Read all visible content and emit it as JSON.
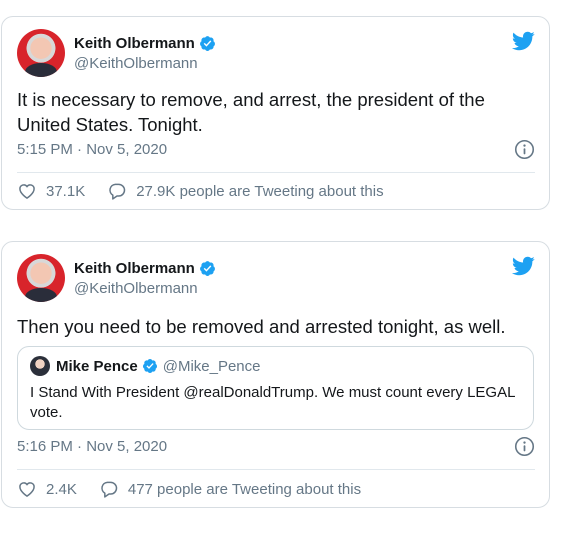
{
  "tweets": [
    {
      "author_name": "Keith Olbermann",
      "author_handle": "@KeithOlbermann",
      "text": "It is necessary to remove, and arrest, the president of the United States. Tonight.",
      "timestamp": "5:15 PM · Nov 5, 2020",
      "likes": "37.1K",
      "replies_text": "27.9K people are Tweeting about this"
    },
    {
      "author_name": "Keith Olbermann",
      "author_handle": "@KeithOlbermann",
      "text": "Then you need to be removed and arrested tonight, as well.",
      "quote": {
        "author_name": "Mike Pence",
        "author_handle": "@Mike_Pence",
        "text": "I Stand With President @realDonaldTrump. We must count every LEGAL vote."
      },
      "timestamp": "5:16 PM · Nov 5, 2020",
      "likes": "2.4K",
      "replies_text": "477 people are Tweeting about this"
    }
  ],
  "icons": {
    "brand": "twitter-bird-icon",
    "verified": "verified-badge-icon",
    "info": "info-icon",
    "like": "heart-icon",
    "reply": "speech-bubble-icon"
  },
  "colors": {
    "twitter_blue": "#1da1f2",
    "secondary_text": "#657786",
    "border": "#d7dde2"
  }
}
